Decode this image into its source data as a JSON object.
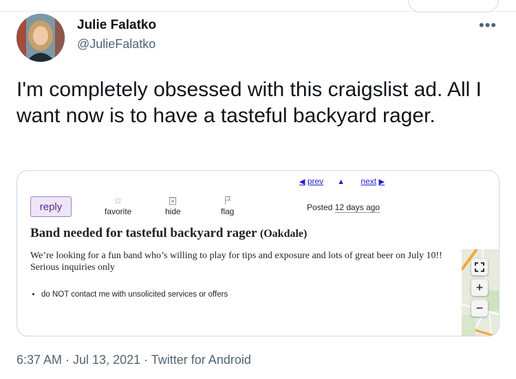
{
  "tweet": {
    "author_name": "Julie Falatko",
    "author_handle": "@JulieFalatko",
    "more_label": "•••",
    "text": "I'm completely obsessed with this craigslist ad. All I want now is to have a tasteful backyard rager.",
    "timestamp": "6:37 AM · Jul 13, 2021 · Twitter for Android"
  },
  "craigslist": {
    "prev_label": "prev",
    "next_label": "next",
    "reply_label": "reply",
    "favorite_label": "favorite",
    "hide_label": "hide",
    "flag_label": "flag",
    "posted_prefix": "Posted",
    "posted_ago": "12 days ago",
    "title": "Band needed for tasteful backyard rager",
    "location": "(Oakdale)",
    "body": "We’re looking for a fun band who’s willing to play for tips and exposure and lots of great beer on July 10!! Serious inquiries only",
    "notices": [
      "do NOT contact me with unsolicited services or offers"
    ],
    "link_color": "#2222cc",
    "reply_color": "#5a2b8f"
  },
  "map_controls": {
    "fullscreen_icon": "fullscreen-icon",
    "zoom_in_label": "+",
    "zoom_out_label": "−"
  }
}
